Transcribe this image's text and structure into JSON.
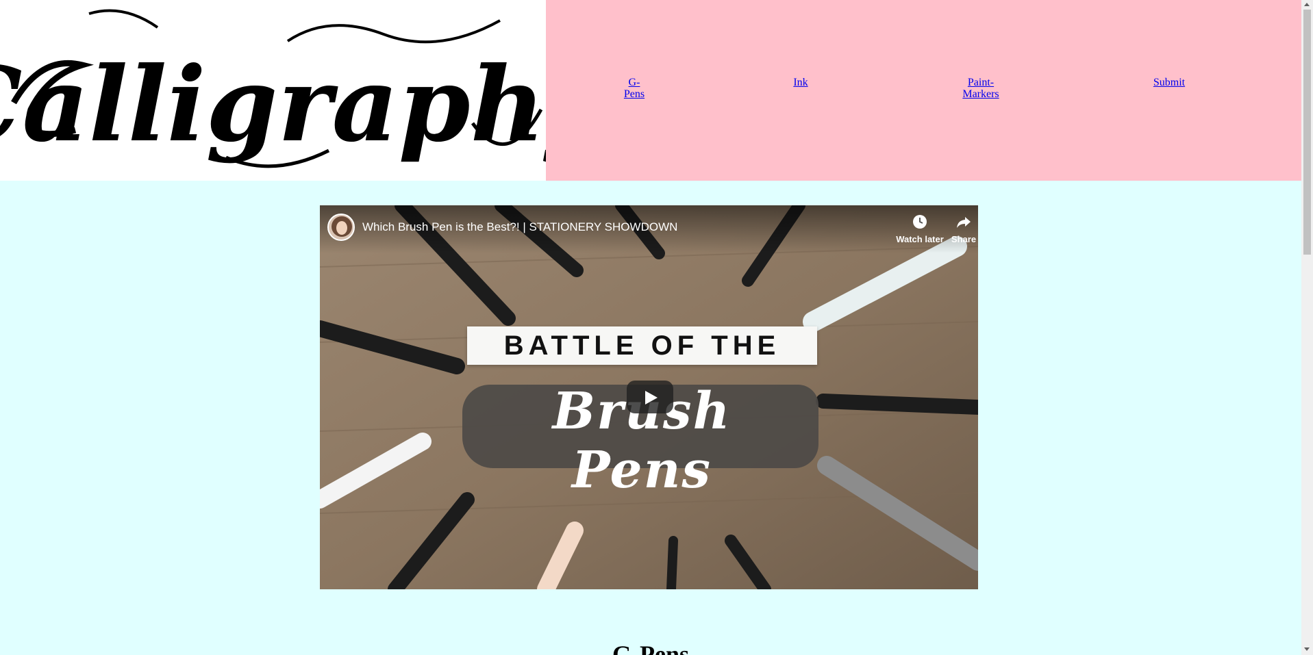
{
  "logo": {
    "text": "Calligraphy"
  },
  "nav": {
    "items": [
      {
        "line1": "G-",
        "line2": "Pens"
      },
      {
        "line1": "Ink",
        "line2": ""
      },
      {
        "line1": "Paint-",
        "line2": "Markers"
      },
      {
        "line1": "Submit",
        "line2": ""
      }
    ]
  },
  "video": {
    "title": "Which Brush Pen is the Best?! | STATIONERY SHOWDOWN",
    "watch_later": "Watch later",
    "share": "Share",
    "thumbnail_banner": "BATTLE OF THE",
    "thumbnail_script": "Brush Pens",
    "icons": {
      "watch_later": "clock-icon",
      "share": "share-icon",
      "play": "play-icon"
    }
  },
  "section": {
    "heading": "G-Pens"
  },
  "colors": {
    "header_bg": "#ffc0cb",
    "page_bg": "#e0ffff",
    "link": "#0000ee"
  }
}
